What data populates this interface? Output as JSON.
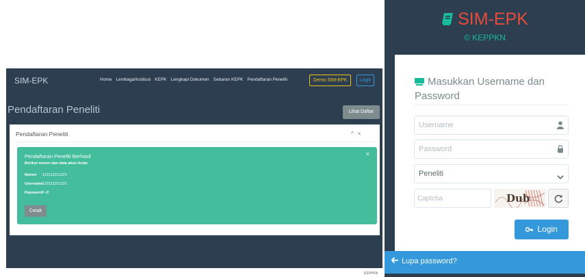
{
  "left_app": {
    "brand": "SIM-EPK",
    "nav_links": [
      "Home",
      "Lembaga/Institusi",
      "KEPK",
      "Lengkapi Dokumen",
      "Sebaran KEPK",
      "Pendaftaran Peneliti"
    ],
    "demo_button": "Demo SIM-EPK",
    "login_button": "Login",
    "page_title": "Pendaftaran Peneliti",
    "lihat_daftar_button": "Lihat Daftar",
    "panel": {
      "title": "Pendaftaran Peneliti",
      "collapse_glyph": "^",
      "close_glyph": "×"
    },
    "alert": {
      "title": "Pendaftaran Peneliti Berhasil",
      "subtitle": "Berikut nomor dan data akun Anda:",
      "close_glyph": "×",
      "rows": [
        {
          "label": "Nomor",
          "value": "122112211221"
        },
        {
          "label": "Username",
          "value": "122112211221"
        },
        {
          "label": "Password",
          "value": "F-i8"
        }
      ],
      "cetak_button": "Cetak"
    },
    "footer": "KEPPKN"
  },
  "right_app": {
    "brand": "SIM-EPK",
    "subtitle": "© KEPPKN",
    "card_title": "Masukkan Username dan Password",
    "username_placeholder": "Username",
    "password_placeholder": "Password",
    "role_selected": "Peneliti",
    "captcha_placeholder": "Captcha",
    "captcha_text": "Dub",
    "login_button": "Login",
    "forgot_link": "Lupa password?"
  },
  "colors": {
    "navy": "#2c3e50",
    "green": "#18bc9c",
    "alert_green": "#43bd9b",
    "blue": "#3498db",
    "red": "#e74c3c",
    "gray_button": "#7f8c8d",
    "yellow": "#f0c419"
  },
  "icons": [
    "book-icon",
    "keyboard-icon",
    "user-icon",
    "lock-icon",
    "chevron-down-icon",
    "refresh-icon",
    "key-icon",
    "arrow-left-icon",
    "collapse-icon",
    "close-icon"
  ]
}
